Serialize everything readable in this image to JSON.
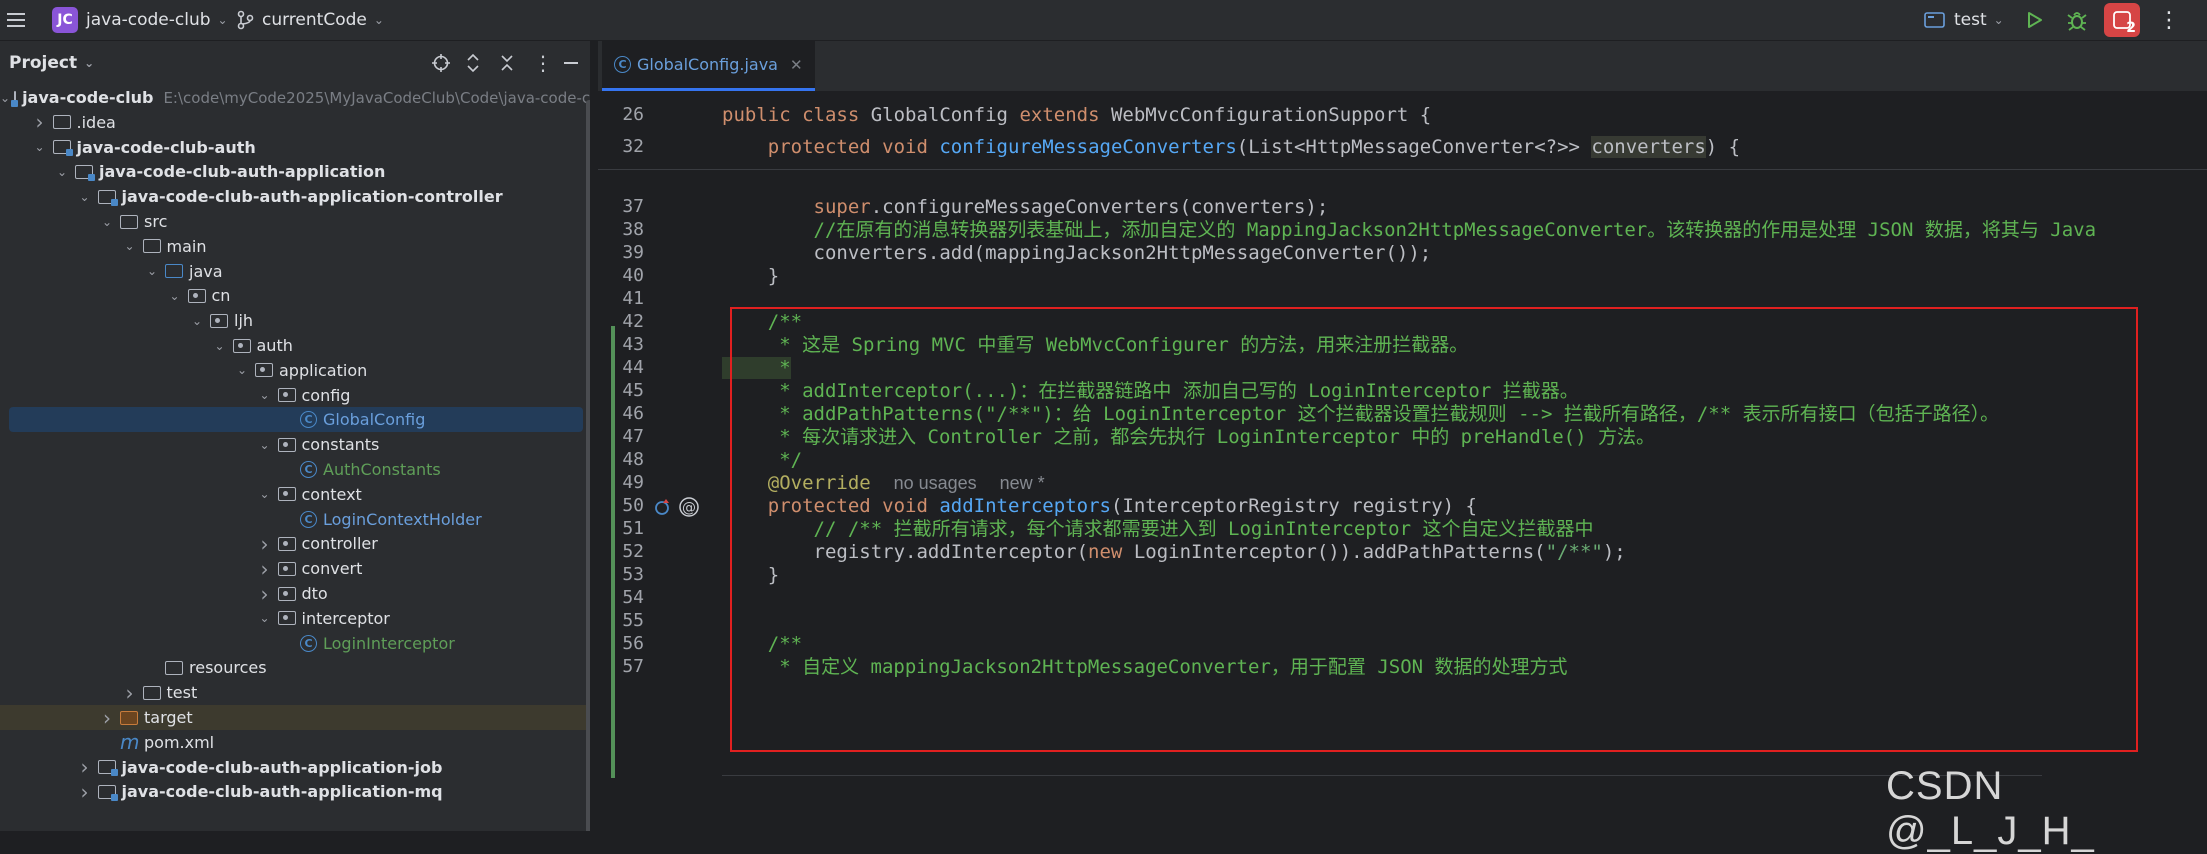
{
  "titlebar": {
    "project_badge": "JC",
    "project_name": "java-code-club",
    "branch_name": "currentCode",
    "run_config": "test",
    "notifications_count": "2"
  },
  "project_panel": {
    "title": "Project",
    "tree": [
      {
        "indent": 0,
        "arrow": "v",
        "icon": "module",
        "label": "java-code-club",
        "bold": true,
        "path": "E:\\code\\myCode2025\\MyJavaCodeClub\\Code\\java-code-c"
      },
      {
        "indent": 1,
        "arrow": ">",
        "icon": "folder",
        "label": ".idea"
      },
      {
        "indent": 1,
        "arrow": "v",
        "icon": "module",
        "label": "java-code-club-auth",
        "bold": true
      },
      {
        "indent": 2,
        "arrow": "v",
        "icon": "module",
        "label": "java-code-club-auth-application",
        "bold": true
      },
      {
        "indent": 3,
        "arrow": "v",
        "icon": "module",
        "label": "java-code-club-auth-application-controller",
        "bold": true
      },
      {
        "indent": 4,
        "arrow": "v",
        "icon": "folder",
        "label": "src"
      },
      {
        "indent": 5,
        "arrow": "v",
        "icon": "folder",
        "label": "main"
      },
      {
        "indent": 6,
        "arrow": "v",
        "icon": "src",
        "label": "java"
      },
      {
        "indent": 7,
        "arrow": "v",
        "icon": "pkg",
        "label": "cn"
      },
      {
        "indent": 8,
        "arrow": "v",
        "icon": "pkg",
        "label": "ljh"
      },
      {
        "indent": 9,
        "arrow": "v",
        "icon": "pkg",
        "label": "auth"
      },
      {
        "indent": 10,
        "arrow": "v",
        "icon": "pkg",
        "label": "application"
      },
      {
        "indent": 11,
        "arrow": "v",
        "icon": "pkg",
        "label": "config"
      },
      {
        "indent": 12,
        "arrow": "",
        "icon": "class",
        "label": "GlobalConfig",
        "color": "blue",
        "selected": true
      },
      {
        "indent": 11,
        "arrow": "v",
        "icon": "pkg",
        "label": "constants"
      },
      {
        "indent": 12,
        "arrow": "",
        "icon": "class",
        "label": "AuthConstants",
        "color": "green"
      },
      {
        "indent": 11,
        "arrow": "v",
        "icon": "pkg",
        "label": "context"
      },
      {
        "indent": 12,
        "arrow": "",
        "icon": "class",
        "label": "LoginContextHolder",
        "color": "blue"
      },
      {
        "indent": 11,
        "arrow": ">",
        "icon": "pkg",
        "label": "controller"
      },
      {
        "indent": 11,
        "arrow": ">",
        "icon": "pkg",
        "label": "convert"
      },
      {
        "indent": 11,
        "arrow": ">",
        "icon": "pkg",
        "label": "dto"
      },
      {
        "indent": 11,
        "arrow": "v",
        "icon": "pkg",
        "label": "interceptor"
      },
      {
        "indent": 12,
        "arrow": "",
        "icon": "class",
        "label": "LoginInterceptor",
        "color": "green"
      },
      {
        "indent": 6,
        "arrow": "",
        "icon": "res",
        "label": "resources"
      },
      {
        "indent": 5,
        "arrow": ">",
        "icon": "folder",
        "label": "test"
      },
      {
        "indent": 4,
        "arrow": ">",
        "icon": "orange",
        "label": "target",
        "highlight": true
      },
      {
        "indent": 4,
        "arrow": "",
        "icon": "maven",
        "label": "pom.xml"
      },
      {
        "indent": 3,
        "arrow": ">",
        "icon": "module",
        "label": "java-code-club-auth-application-job",
        "bold": true
      },
      {
        "indent": 3,
        "arrow": ">",
        "icon": "module",
        "label": "java-code-club-auth-application-mq",
        "bold": true
      }
    ]
  },
  "editor": {
    "tab_label": "GlobalConfig.java",
    "sticky_lines": [
      {
        "num": "26",
        "code": "public class GlobalConfig extends WebMvcConfigurationSupport {"
      },
      {
        "num": "32",
        "code": "    protected void configureMessageConverters(List<HttpMessageConverter<?>> converters) {"
      }
    ],
    "line_numbers": [
      "37",
      "38",
      "39",
      "40",
      "41",
      "42",
      "43",
      "44",
      "45",
      "46",
      "47",
      "48",
      "49",
      "50",
      "51",
      "52",
      "53",
      "54",
      "55",
      "56",
      "57"
    ],
    "lines": {
      "l37": "        super.configureMessageConverters(converters);",
      "l38": "        //在原有的消息转换器列表基础上，添加自定义的 MappingJackson2HttpMessageConverter。该转换器的作用是处理 JSON 数据，将其与 Java",
      "l39": "        converters.add(mappingJackson2HttpMessageConverter());",
      "l40": "    }",
      "l42": "    /**",
      "l43": "     * 这是 Spring MVC 中重写 WebMvcConfigurer 的方法，用来注册拦截器。",
      "l44": "     *",
      "l45": "     * addInterceptor(...)：在拦截器链路中 添加自己写的 LoginInterceptor 拦截器。",
      "l46": "     * addPathPatterns(\"/**\")：给 LoginInterceptor 这个拦截器设置拦截规则 --> 拦截所有路径，/** 表示所有接口（包括子路径）。",
      "l47": "     * 每次请求进入 Controller 之前，都会先执行 LoginInterceptor 中的 preHandle() 方法。",
      "l48": "     */",
      "l49_ann": "@Override",
      "l49_hint1": "no usages",
      "l49_hint2": "new *",
      "l50_kw": "protected void ",
      "l50_fn": "addInterceptors",
      "l50_rest": "(InterceptorRegistry registry) {",
      "l51": "        // /** 拦截所有请求，每个请求都需要进入到 LoginInterceptor 这个自定义拦截器中",
      "l52_a": "        registry.addInterceptor(",
      "l52_kw": "new",
      "l52_b": " LoginInterceptor()).addPathPatterns(",
      "l52_str": "\"/**\"",
      "l52_c": ");",
      "l53": "    }",
      "l56": "    /**",
      "l57": "     * 自定义 mappingJackson2HttpMessageConverter，用于配置 JSON 数据的处理方式"
    }
  },
  "watermark": "CSDN @_L_J_H_"
}
